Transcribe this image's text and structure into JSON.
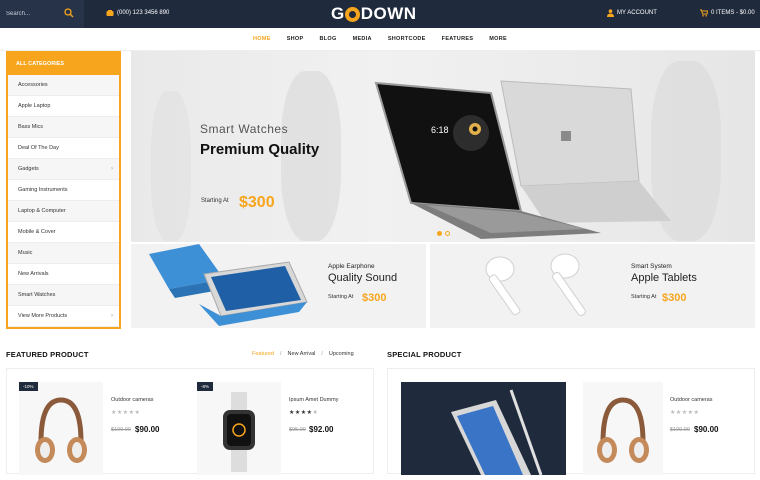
{
  "header": {
    "search_placeholder": "Search...",
    "phone": "(000) 123 3456 890",
    "logo": "GODOWN",
    "account": "MY ACCOUNT",
    "cart": "0 ITEMS - $0.00"
  },
  "nav": [
    "HOME",
    "SHOP",
    "BLOG",
    "MEDIA",
    "SHORTCODE",
    "FEATURES",
    "MORE"
  ],
  "categories": {
    "title": "ALL CATEGORIES",
    "items": [
      {
        "label": "Accessories",
        "arrow": ""
      },
      {
        "label": "Apple Laptop",
        "arrow": ""
      },
      {
        "label": "Bass Mics",
        "arrow": ""
      },
      {
        "label": "Deal Of The Day",
        "arrow": ""
      },
      {
        "label": "Gadgets",
        "arrow": "›"
      },
      {
        "label": "Gaming Instruments",
        "arrow": ""
      },
      {
        "label": "Laptop & Computer",
        "arrow": ""
      },
      {
        "label": "Mobile & Cover",
        "arrow": ""
      },
      {
        "label": "Music",
        "arrow": ""
      },
      {
        "label": "New Arrivals",
        "arrow": ""
      },
      {
        "label": "Smart Watches",
        "arrow": ""
      },
      {
        "label": "View More Products",
        "arrow": "›"
      }
    ]
  },
  "hero": {
    "subtitle": "Smart Watches",
    "title": "Premium Quality",
    "starting_label": "Starting At",
    "price": "$300",
    "slide_count": 2,
    "active_slide": 1
  },
  "banners": [
    {
      "sub": "Apple Earphone",
      "title": "Quality Sound",
      "starting_label": "Starting At",
      "price": "$300"
    },
    {
      "sub": "Smart System",
      "title": "Apple Tablets",
      "starting_label": "Starting At",
      "price": "$300"
    }
  ],
  "featured": {
    "title": "FEATURED PRODUCT",
    "tabs": [
      "Featured",
      "New Arrival",
      "Upcoming"
    ],
    "products": [
      {
        "badge": "-10%",
        "name": "Outdoor cameras",
        "stars": "★★★★★",
        "rating": 0,
        "old_price": "$100.00",
        "price": "$90.00"
      },
      {
        "badge": "-8%",
        "name": "Ipsum Amet Dummy",
        "stars": "★★★★★",
        "rating": 4,
        "old_price": "$95.00",
        "price": "$92.00"
      }
    ]
  },
  "special": {
    "title": "SPECIAL PRODUCT",
    "product": {
      "name": "Outdoor cameras",
      "stars": "★★★★★",
      "rating": 0,
      "old_price": "$100.00",
      "price": "$90.00"
    }
  },
  "colors": {
    "accent": "#f7a51c",
    "dark": "#1f2a3c"
  }
}
